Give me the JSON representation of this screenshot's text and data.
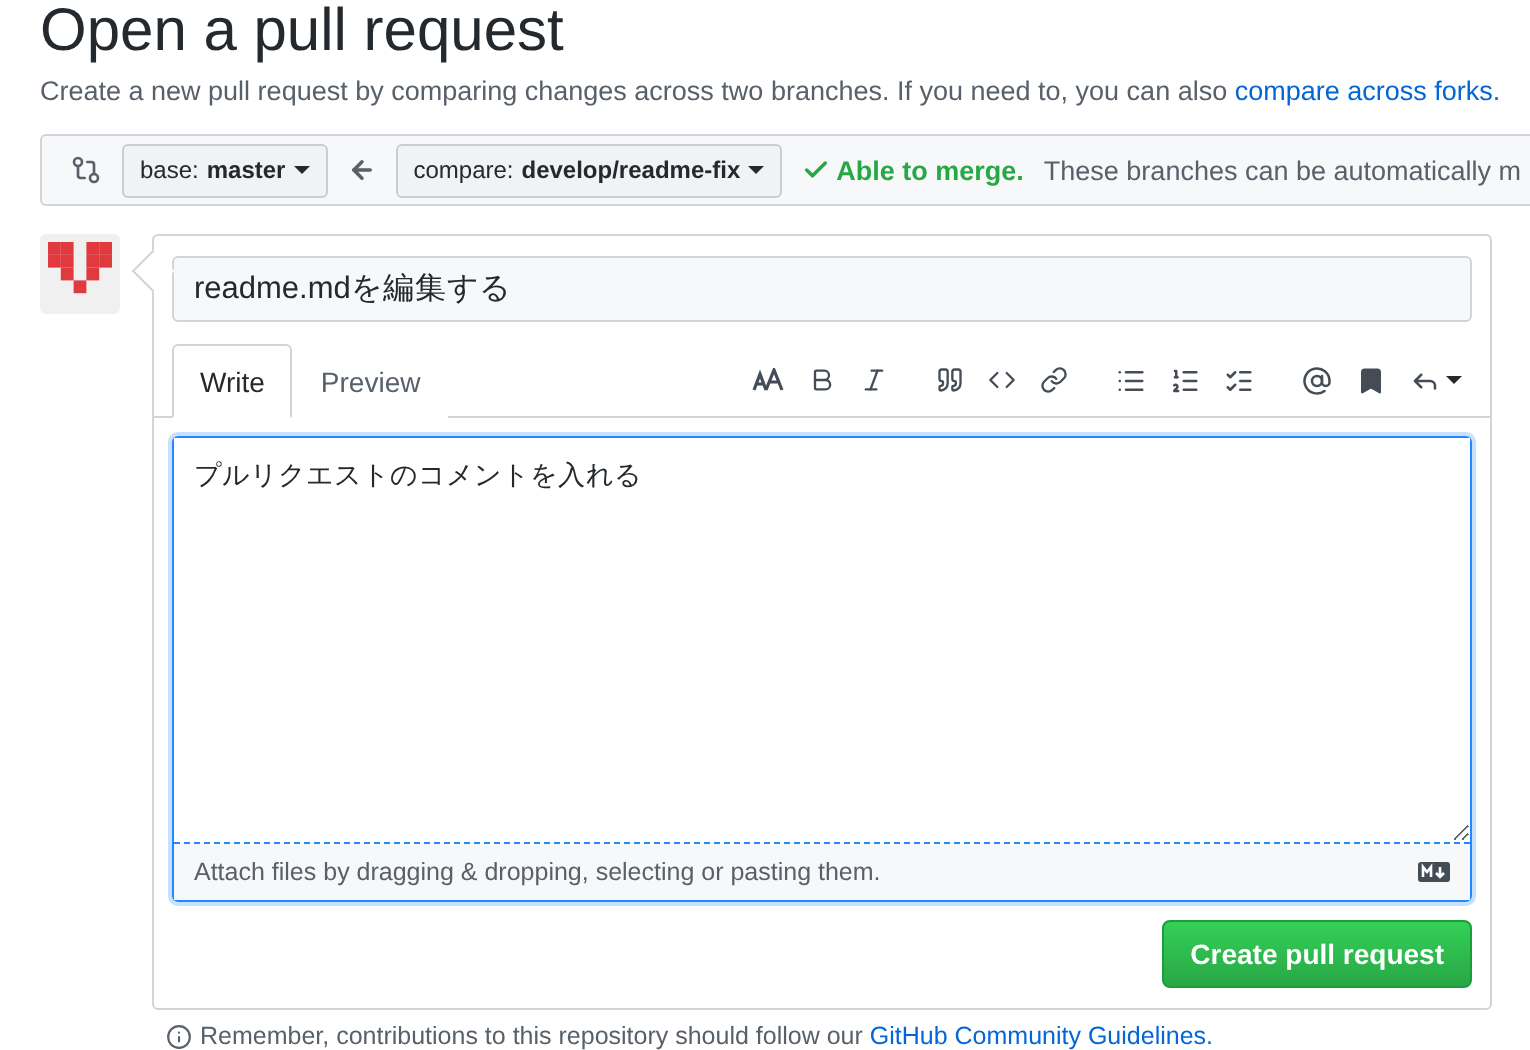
{
  "page_title": "Open a pull request",
  "intro": {
    "text": "Create a new pull request by comparing changes across two branches. If you need to, you can also",
    "link": "compare across forks."
  },
  "compare_bar": {
    "base": {
      "label": "base:",
      "value": "master"
    },
    "compare": {
      "label": "compare:",
      "value": "develop/readme-fix"
    },
    "merge_status": {
      "ok": true,
      "label": "Able to merge.",
      "detail": "These branches can be automatically m"
    }
  },
  "form": {
    "title_field": {
      "value": "readme.mdを編集する"
    },
    "tabs": [
      {
        "label": "Write",
        "selected": true
      },
      {
        "label": "Preview",
        "selected": false
      }
    ],
    "body": {
      "value": "プルリクエストのコメントを入れる"
    },
    "attach_hint": "Attach files by dragging & dropping, selecting or pasting them.",
    "submit": "Create pull request"
  },
  "footer": {
    "text": "Remember, contributions to this repository should follow our",
    "link": "GitHub Community Guidelines."
  }
}
